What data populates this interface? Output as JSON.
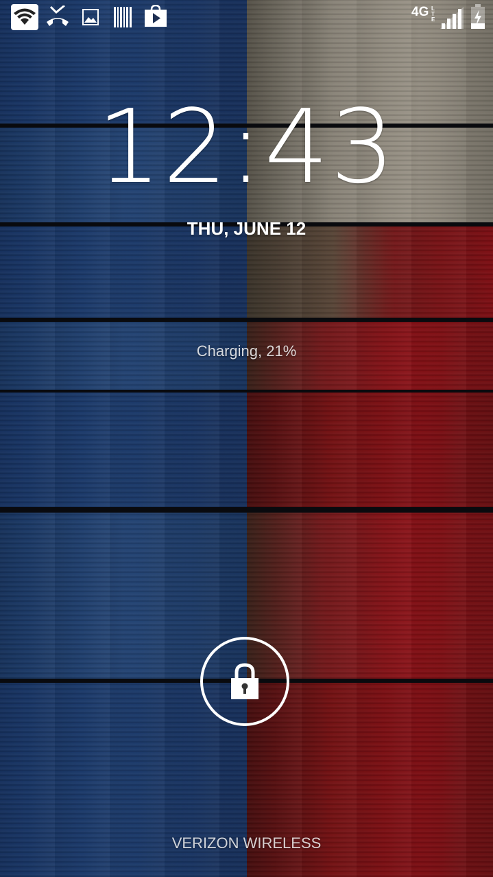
{
  "status_bar": {
    "left_icons": [
      "wifi-icon",
      "missed-call-icon",
      "image-icon",
      "barcode-icon",
      "play-store-icon"
    ],
    "network_label": "4G",
    "network_sub_label": "LTE",
    "right_icons": [
      "signal-icon",
      "battery-charging-icon"
    ]
  },
  "lockscreen": {
    "time": "12:43",
    "date": "THU, JUNE 12",
    "charging_status": "Charging, 21%",
    "carrier": "VERIZON WIRELESS",
    "unlock_icon": "lock-icon"
  },
  "wallpaper": {
    "left_color": "#22467f",
    "right_top_color": "#b5ad9f",
    "right_bottom_color": "#9b141a"
  }
}
